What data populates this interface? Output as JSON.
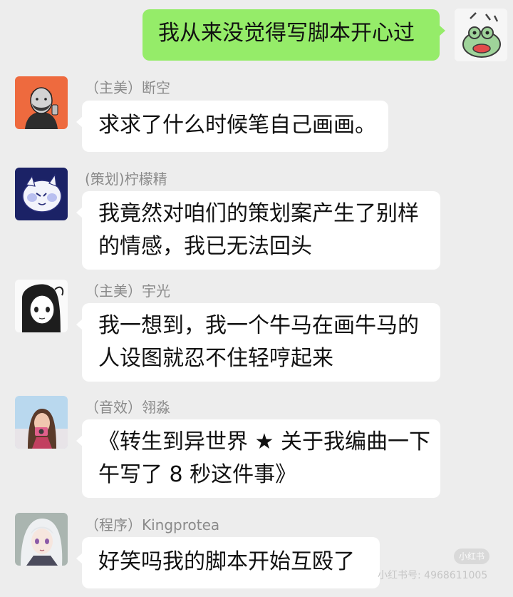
{
  "messages": [
    {
      "side": "right",
      "name": "",
      "lines": [
        "我从来没觉得写脚本开心过"
      ],
      "avatar_icon": "frog-sticker-avatar"
    },
    {
      "side": "left",
      "name": "（主美）断空",
      "lines": [
        "求求了什么时候笔自己画画。"
      ],
      "avatar_icon": "bearded-man-avatar"
    },
    {
      "side": "left",
      "name": "(策划)柠檬精",
      "lines": [
        "我竟然对咱们的策划案产生了别样",
        "的情感，我已无法回头"
      ],
      "avatar_icon": "white-creature-avatar"
    },
    {
      "side": "left",
      "name": "（主美）宇光",
      "lines": [
        "我一想到，我一个牛马在画牛马的",
        "人设图就忍不住轻哼起来"
      ],
      "avatar_icon": "manga-girl-avatar"
    },
    {
      "side": "left",
      "name": "（音效）翎淼",
      "lines": [
        "《转生到异世界 ★ 关于我编曲一下",
        "午写了 8 秒这件事》"
      ],
      "avatar_icon": "photo-girl-avatar"
    },
    {
      "side": "left",
      "name": "（程序）Kingprotea",
      "lines": [
        "好笑吗我的脚本开始互殴了"
      ],
      "avatar_icon": "anime-silver-hair-avatar"
    }
  ],
  "watermark": {
    "badge": "小红书",
    "id": "小红书号: 4968611005"
  },
  "colors": {
    "background": "#ededed",
    "bubble_self": "#95ec69",
    "bubble_other": "#ffffff",
    "name_text": "#8a8a8a"
  }
}
